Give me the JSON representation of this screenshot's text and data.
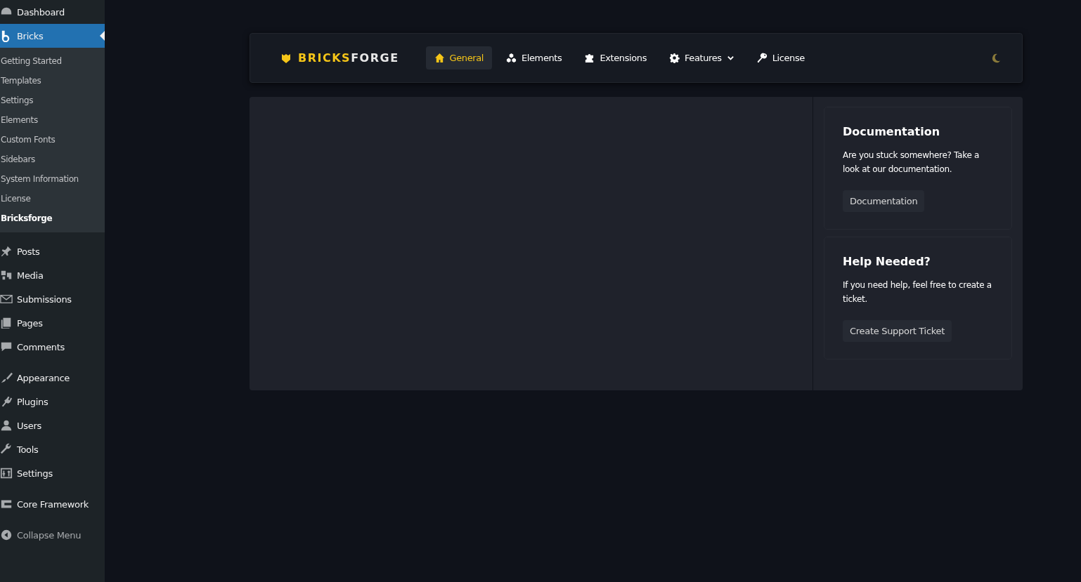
{
  "sidebar": {
    "groups": [
      {
        "items": [
          {
            "label": "Dashboard",
            "selected": false
          },
          {
            "label": "Bricks",
            "selected": true,
            "submenu": [
              {
                "label": "Getting Started",
                "selected": false
              },
              {
                "label": "Templates",
                "selected": false
              },
              {
                "label": "Settings",
                "selected": false
              },
              {
                "label": "Elements",
                "selected": false
              },
              {
                "label": "Custom Fonts",
                "selected": false
              },
              {
                "label": "Sidebars",
                "selected": false
              },
              {
                "label": "System Information",
                "selected": false
              },
              {
                "label": "License",
                "selected": false
              },
              {
                "label": "Bricksforge",
                "selected": true
              }
            ]
          }
        ]
      },
      {
        "items": [
          {
            "label": "Posts",
            "selected": false
          },
          {
            "label": "Media",
            "selected": false
          },
          {
            "label": "Submissions",
            "selected": false
          },
          {
            "label": "Pages",
            "selected": false
          },
          {
            "label": "Comments",
            "selected": false
          }
        ]
      },
      {
        "items": [
          {
            "label": "Appearance",
            "selected": false
          },
          {
            "label": "Plugins",
            "selected": false
          },
          {
            "label": "Users",
            "selected": false
          },
          {
            "label": "Tools",
            "selected": false
          },
          {
            "label": "Settings",
            "selected": false
          }
        ]
      },
      {
        "items": [
          {
            "label": "Core Framework",
            "selected": false
          }
        ]
      }
    ],
    "collapse": "Collapse Menu"
  },
  "header": {
    "logo": {
      "accent": "BRICKS",
      "rest": "FORGE"
    },
    "nav": [
      {
        "label": "General",
        "selected": true,
        "dropdown": false
      },
      {
        "label": "Elements",
        "selected": false,
        "dropdown": false
      },
      {
        "label": "Extensions",
        "selected": false,
        "dropdown": false
      },
      {
        "label": "Features",
        "selected": false,
        "dropdown": true
      },
      {
        "label": "License",
        "selected": false,
        "dropdown": false
      }
    ]
  },
  "cards": [
    {
      "title": "Documentation",
      "text": "Are you stuck somewhere? Take a look at our documentation.",
      "button": "Documentation"
    },
    {
      "title": "Help Needed?",
      "text": "If you need help, feel free to create a ticket.",
      "button": "Create Support Ticket"
    }
  ]
}
